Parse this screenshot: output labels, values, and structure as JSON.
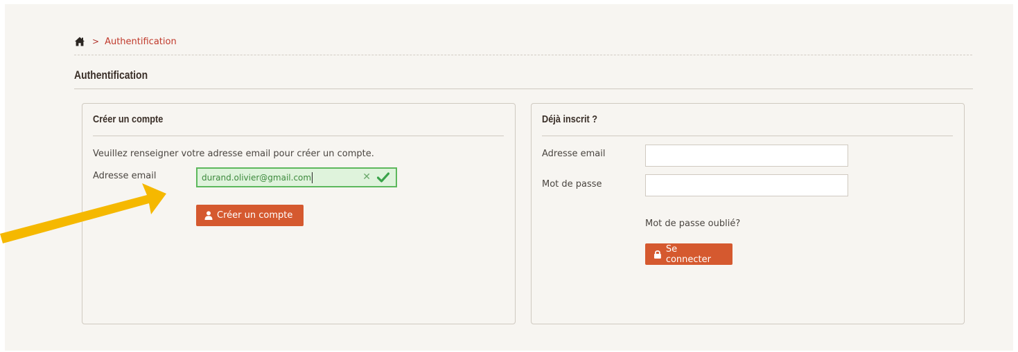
{
  "breadcrumb": {
    "separator": ">",
    "current": "Authentification"
  },
  "page_title": "Authentification",
  "create_account": {
    "title": "Créer un compte",
    "intro": "Veuillez renseigner votre adresse email pour créer un compte.",
    "email_label": "Adresse email",
    "email_value": "durand.olivier@gmail.com",
    "button_label": "Créer un compte"
  },
  "login": {
    "title": "Déjà inscrit ?",
    "email_label": "Adresse email",
    "password_label": "Mot de passe",
    "forgot_label": "Mot de passe oublié?",
    "button_label": "Se connecter"
  },
  "icons": {
    "home": "home-icon",
    "user": "user-icon",
    "lock": "lock-icon",
    "check": "check-icon",
    "clear": "clear-icon"
  },
  "colors": {
    "accent": "#d5592f",
    "link": "#c0392b",
    "valid_border": "#5cb85c",
    "valid_bg": "#dff3dc",
    "arrow": "#f5b800"
  }
}
